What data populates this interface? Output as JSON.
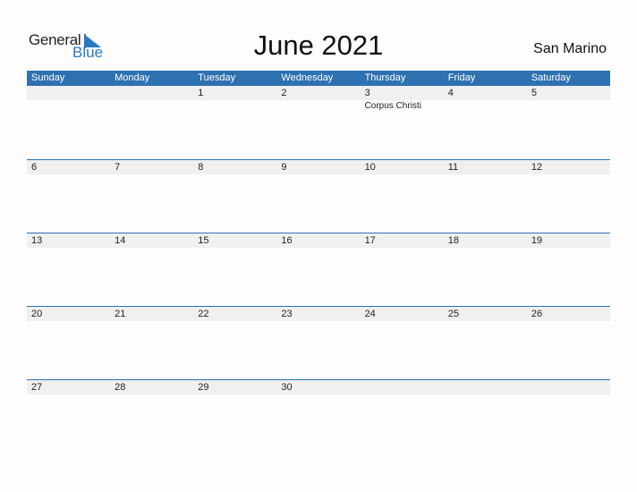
{
  "logo": {
    "general": "General",
    "blue": "Blue"
  },
  "title": "June 2021",
  "country": "San Marino",
  "weekdays": [
    "Sunday",
    "Monday",
    "Tuesday",
    "Wednesday",
    "Thursday",
    "Friday",
    "Saturday"
  ],
  "weeks": [
    {
      "days": [
        "",
        "",
        "1",
        "2",
        "3",
        "4",
        "5"
      ],
      "events": [
        "",
        "",
        "",
        "",
        "Corpus Christi",
        "",
        ""
      ]
    },
    {
      "days": [
        "6",
        "7",
        "8",
        "9",
        "10",
        "11",
        "12"
      ],
      "events": [
        "",
        "",
        "",
        "",
        "",
        "",
        ""
      ]
    },
    {
      "days": [
        "13",
        "14",
        "15",
        "16",
        "17",
        "18",
        "19"
      ],
      "events": [
        "",
        "",
        "",
        "",
        "",
        "",
        ""
      ]
    },
    {
      "days": [
        "20",
        "21",
        "22",
        "23",
        "24",
        "25",
        "26"
      ],
      "events": [
        "",
        "",
        "",
        "",
        "",
        "",
        ""
      ]
    },
    {
      "days": [
        "27",
        "28",
        "29",
        "30",
        "",
        "",
        ""
      ],
      "events": [
        "",
        "",
        "",
        "",
        "",
        "",
        ""
      ]
    }
  ],
  "colors": {
    "accent": "#2e71b1",
    "strip": "#f0f0f0"
  }
}
